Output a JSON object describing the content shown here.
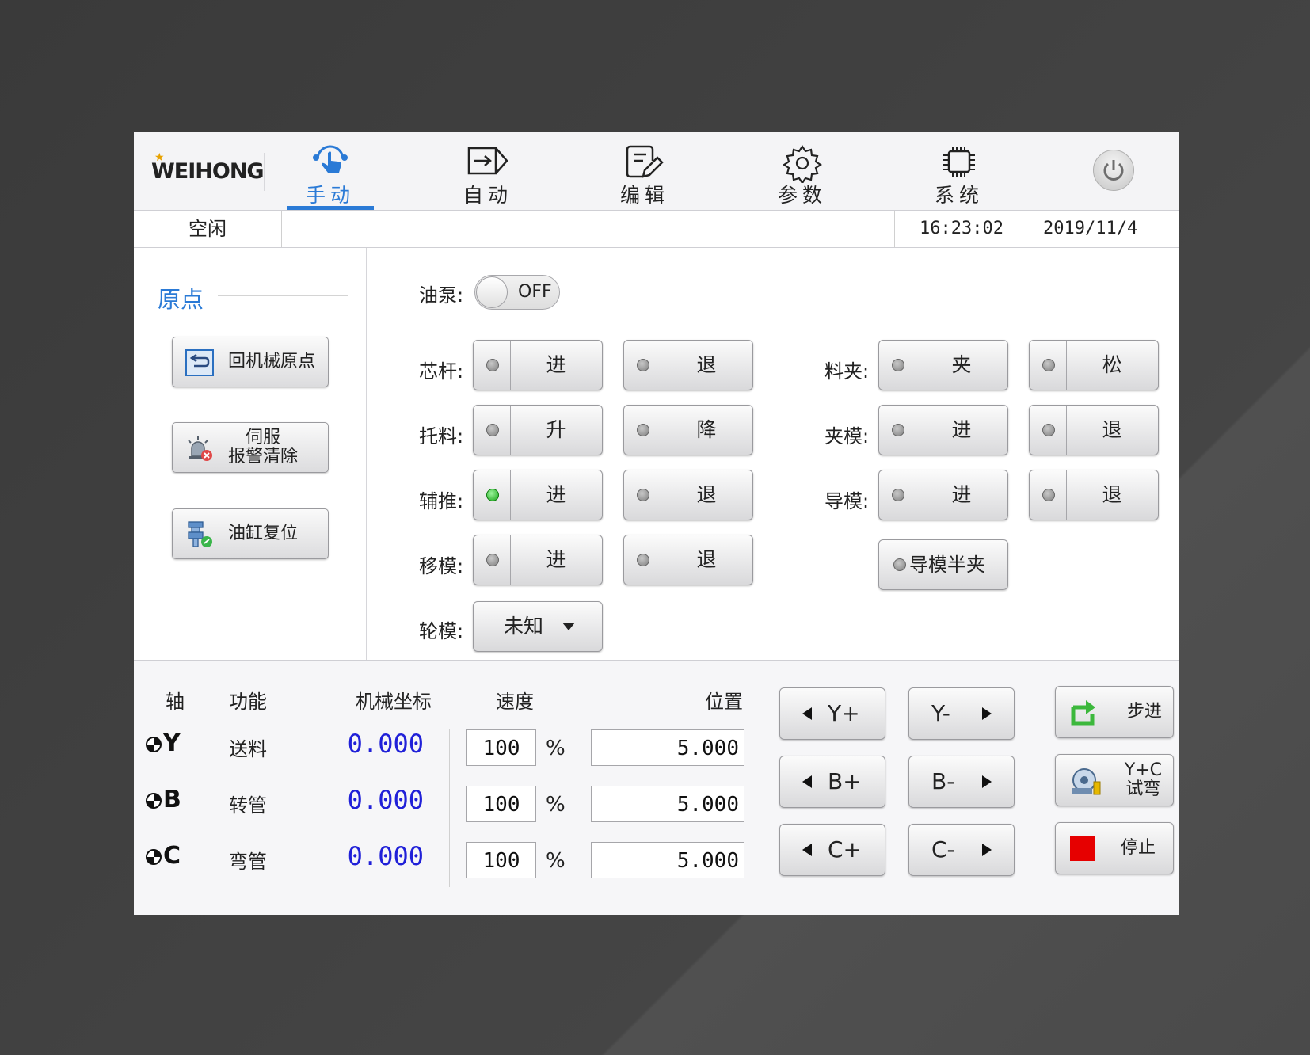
{
  "logo": "WEIHONG",
  "nav": {
    "tabs": [
      {
        "label": "手动",
        "icon": "hand-touch-icon",
        "active": true
      },
      {
        "label": "自动",
        "icon": "auto-run-icon"
      },
      {
        "label": "编辑",
        "icon": "edit-document-icon"
      },
      {
        "label": "参数",
        "icon": "gear-icon"
      },
      {
        "label": "系统",
        "icon": "chip-icon"
      }
    ],
    "power_icon": "power-icon"
  },
  "status": {
    "state": "空闲",
    "time": "16:23:02",
    "date": "2019/11/4"
  },
  "origin": {
    "title": "原点",
    "buttons": [
      {
        "label": "回机械原点",
        "icon": "return-origin-icon"
      },
      {
        "label_line1": "伺服",
        "label_line2": "报警清除",
        "icon": "alarm-clear-icon"
      },
      {
        "label": "油缸复位",
        "icon": "cylinder-reset-icon"
      }
    ]
  },
  "controls": {
    "oil_pump": {
      "label": "油泵:",
      "state": "OFF"
    },
    "mandrel": {
      "label": "芯杆:",
      "a": "进",
      "b": "退"
    },
    "support": {
      "label": "托料:",
      "a": "升",
      "b": "降"
    },
    "assist_push": {
      "label": "辅推:",
      "a": "进",
      "b": "退",
      "a_on": true
    },
    "move_die": {
      "label": "移模:",
      "a": "进",
      "b": "退"
    },
    "wheel_die": {
      "label": "轮模:",
      "value": "未知"
    },
    "clamp": {
      "label": "料夹:",
      "a": "夹",
      "b": "松"
    },
    "clamp_die": {
      "label": "夹模:",
      "a": "进",
      "b": "退"
    },
    "guide_die": {
      "label": "导模:",
      "a": "进",
      "b": "退"
    },
    "guide_half": {
      "label": "导模半夹"
    }
  },
  "axes": {
    "headers": {
      "axis": "轴",
      "func": "功能",
      "coord": "机械坐标",
      "speed": "速度",
      "pos": "位置"
    },
    "rows": [
      {
        "axis": "Y",
        "func": "送料",
        "coord": "0.000",
        "speed": "100",
        "pct": "%",
        "pos": "5.000"
      },
      {
        "axis": "B",
        "func": "转管",
        "coord": "0.000",
        "speed": "100",
        "pct": "%",
        "pos": "5.000"
      },
      {
        "axis": "C",
        "func": "弯管",
        "coord": "0.000",
        "speed": "100",
        "pct": "%",
        "pos": "5.000"
      }
    ]
  },
  "jog": {
    "yplus": "Y+",
    "yminus": "Y-",
    "bplus": "B+",
    "bminus": "B-",
    "cplus": "C+",
    "cminus": "C-"
  },
  "functions": {
    "step": "步进",
    "trial_l1": "Y+C",
    "trial_l2": "试弯",
    "stop": "停止"
  },
  "colors": {
    "accent": "#2a7ad6",
    "coord": "#2020d8",
    "led_on": "#17a317",
    "stop": "#e60000"
  }
}
